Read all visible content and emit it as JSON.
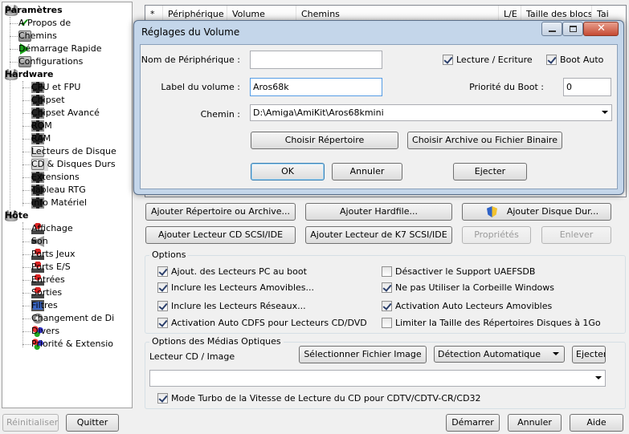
{
  "tree": {
    "items": [
      {
        "label": "Paramètres",
        "icon": "database-icon"
      },
      {
        "label": "A Propos de",
        "icon": "checkmark-icon"
      },
      {
        "label": "Chemins",
        "icon": "folder-icon"
      },
      {
        "label": "Démarrage Rapide",
        "icon": "play-arrow-icon"
      },
      {
        "label": "Configurations",
        "icon": "settings-icon"
      },
      {
        "label": "Hardware",
        "icon": "database-icon"
      },
      {
        "label": "CPU et FPU",
        "icon": "chip-icon"
      },
      {
        "label": "Chipset",
        "icon": "chip-icon"
      },
      {
        "label": "Chipset Avancé",
        "icon": "chip-icon"
      },
      {
        "label": "ROM",
        "icon": "chip-icon"
      },
      {
        "label": "RAM",
        "icon": "chip-icon"
      },
      {
        "label": "Lecteurs de Disque",
        "icon": "drive-icon"
      },
      {
        "label": "CD & Disques Durs",
        "icon": "harddisk-icon"
      },
      {
        "label": "Extensions",
        "icon": "chip-icon"
      },
      {
        "label": "Tableau RTG",
        "icon": "chip-icon"
      },
      {
        "label": "Info Matériel",
        "icon": "chip-icon"
      },
      {
        "label": "Hôte",
        "icon": "database-icon"
      },
      {
        "label": "Affichage",
        "icon": "joystick-icon"
      },
      {
        "label": "Son",
        "icon": "speaker-icon"
      },
      {
        "label": "Ports Jeux",
        "icon": "joystick-icon"
      },
      {
        "label": "Ports E/S",
        "icon": "joystick-icon"
      },
      {
        "label": "Entrées",
        "icon": "joystick-icon"
      },
      {
        "label": "Sorties",
        "icon": "joystick-icon"
      },
      {
        "label": "Filtres",
        "icon": "monitor-icon"
      },
      {
        "label": "Changement de Di",
        "icon": "gear-icon"
      },
      {
        "label": "Divers",
        "icon": "misc-icon"
      },
      {
        "label": "Priorité & Extensio",
        "icon": "misc-icon"
      }
    ]
  },
  "table": {
    "headers": [
      "*",
      "Périphérique",
      "Volume",
      "Chemins",
      "L/E",
      "Taille des blocs",
      "Tai"
    ]
  },
  "dialog": {
    "title": "Réglages du Volume",
    "device_name_label": "Nom de Périphérique :",
    "device_name_value": "",
    "volume_label_label": "Label du volume :",
    "volume_label_value": "Aros68k",
    "path_label": "Chemin :",
    "path_value": "D:\\Amiga\\AmiKit\\Aros68kmini",
    "readwrite_label": "Lecture / Ecriture",
    "readwrite_checked": true,
    "bootauto_label": "Boot Auto",
    "bootauto_checked": true,
    "boot_priority_label": "Priorité du Boot :",
    "boot_priority_value": "0",
    "choose_dir_label": "Choisir Répertoire",
    "choose_archive_label": "Choisir Archive ou Fichier Binaire",
    "ok_label": "OK",
    "cancel_label": "Annuler",
    "eject_label": "Ejecter"
  },
  "actions": {
    "add_dir_label": "Ajouter Répertoire ou Archive...",
    "add_hardfile_label": "Ajouter Hardfile...",
    "add_harddrive_label": "Ajouter Disque Dur...",
    "add_cd_label": "Ajouter Lecteur CD SCSI/IDE",
    "add_tape_label": "Ajouter Lecteur de K7 SCSI/IDE",
    "properties_label": "Propriétés",
    "remove_label": "Enlever"
  },
  "options": {
    "title": "Options",
    "items": [
      {
        "label": "Ajout. des Lecteurs PC au boot",
        "checked": true
      },
      {
        "label": "Désactiver le Support UAEFSDB",
        "checked": false
      },
      {
        "label": "Inclure les Lecteurs Amovibles...",
        "checked": true
      },
      {
        "label": "Ne pas Utiliser la Corbeille Windows",
        "checked": true
      },
      {
        "label": "Inclure les Lecteurs Réseaux...",
        "checked": true
      },
      {
        "label": "Activation Auto Lecteurs Amovibles",
        "checked": true
      },
      {
        "label": "Activation Auto CDFS pour Lecteurs CD/DVD",
        "checked": true
      },
      {
        "label": "Limiter la Taille des Répertoires Disques à 1Go",
        "checked": false
      }
    ]
  },
  "optical": {
    "title": "Options des Médias Optiques",
    "cd_label": "Lecteur CD / Image",
    "select_file_label": "Sélectionner Fichier Image",
    "detection_value": "Détection Automatique",
    "eject_label": "Ejecter",
    "image_value": "",
    "turbo_label": "Mode Turbo de la Vitesse de Lecture du CD pour CDTV/CDTV-CR/CD32",
    "turbo_checked": true
  },
  "footer": {
    "reset_label": "Réinitialiser",
    "quit_label": "Quitter",
    "start_label": "Démarrer",
    "cancel_label": "Annuler",
    "help_label": "Aide"
  }
}
